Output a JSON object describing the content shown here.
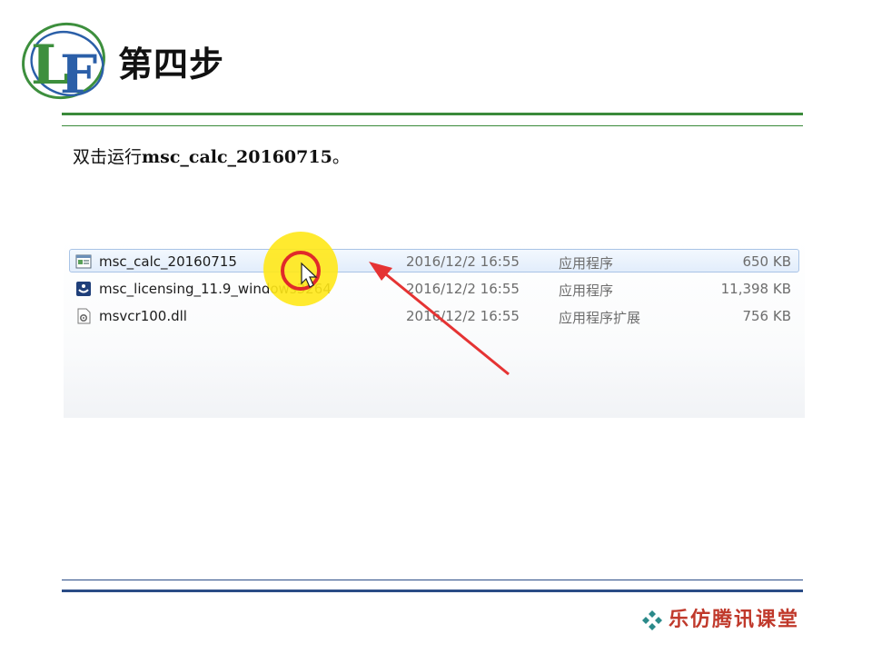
{
  "header": {
    "title": "第四步",
    "logo_letters": "LF"
  },
  "instruction": {
    "prefix": "双击运行",
    "filename": "msc_calc_20160715",
    "suffix": "。"
  },
  "explorer": {
    "files": [
      {
        "name": "msc_calc_20160715",
        "modified": "2016/12/2 16:55",
        "type": "应用程序",
        "size": "650 KB",
        "icon": "application-window-icon"
      },
      {
        "name": "msc_licensing_11.9_windows3264",
        "modified": "2016/12/2 16:55",
        "type": "应用程序",
        "size": "11,398 KB",
        "icon": "installer-app-icon"
      },
      {
        "name": "msvcr100.dll",
        "modified": "2016/12/2 16:55",
        "type": "应用程序扩展",
        "size": "756 KB",
        "icon": "dll-gear-icon"
      }
    ],
    "selected_index": 0
  },
  "footer": {
    "brand": "乐仿腾讯课堂"
  },
  "colors": {
    "green_rule": "#3a8a3a",
    "blue_rule": "#2a4c86",
    "highlight_yellow": "#ffe818",
    "arrow_red": "#e53333",
    "brand_red": "#c0392b"
  }
}
